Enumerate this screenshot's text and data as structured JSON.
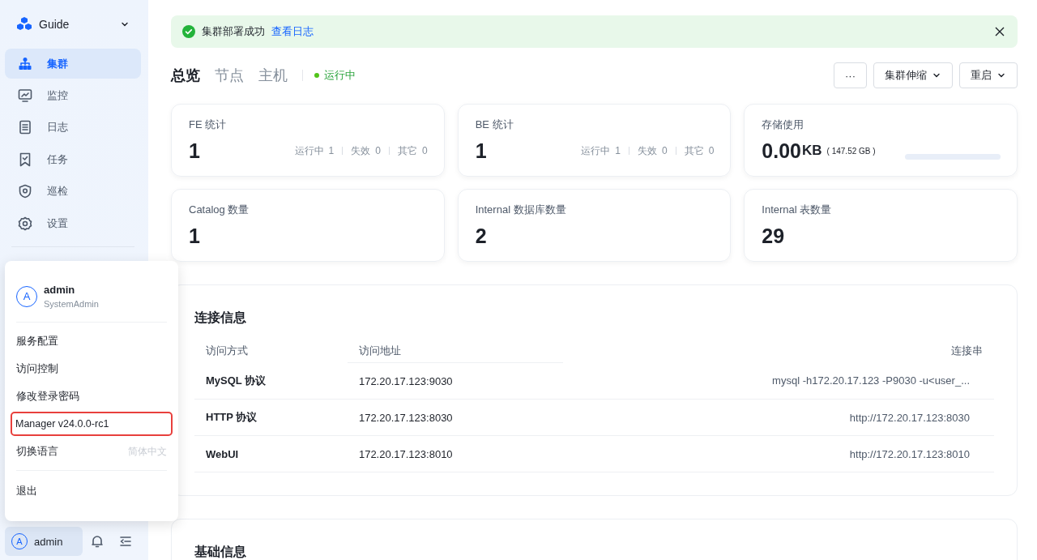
{
  "sidebar": {
    "project": "Guide",
    "nav": [
      {
        "label": "集群",
        "selected": true
      },
      {
        "label": "监控",
        "selected": false
      },
      {
        "label": "日志",
        "selected": false
      },
      {
        "label": "任务",
        "selected": false
      },
      {
        "label": "巡检",
        "selected": false
      },
      {
        "label": "设置",
        "selected": false
      }
    ],
    "user": {
      "avatar": "A",
      "name": "admin"
    }
  },
  "user_menu": {
    "avatar": "A",
    "name": "admin",
    "role": "SystemAdmin",
    "groups": [
      [
        {
          "label": "服务配置",
          "highlighted": false
        },
        {
          "label": "访问控制",
          "highlighted": false
        },
        {
          "label": "修改登录密码",
          "highlighted": false
        },
        {
          "label": "Manager v24.0.0-rc1",
          "highlighted": true
        },
        {
          "label": "切换语言",
          "value": "简体中文",
          "highlighted": false
        }
      ],
      [
        {
          "label": "退出",
          "highlighted": false
        }
      ]
    ]
  },
  "alert": {
    "message": "集群部署成功",
    "link": "查看日志"
  },
  "tabs": [
    {
      "label": "总览",
      "selected": true
    },
    {
      "label": "节点",
      "selected": false
    },
    {
      "label": "主机",
      "selected": false
    }
  ],
  "status": {
    "label": "运行中",
    "color": "#52c41a"
  },
  "actions": [
    {
      "label": "···",
      "dropdown": false
    },
    {
      "label": "集群伸缩",
      "dropdown": true
    },
    {
      "label": "重启",
      "dropdown": true
    }
  ],
  "stats": [
    {
      "kind": "count",
      "title": "FE 统计",
      "value": "1",
      "breakdown": [
        {
          "label": "运行中",
          "value": "1"
        },
        {
          "label": "失效",
          "value": "0"
        },
        {
          "label": "其它",
          "value": "0"
        }
      ]
    },
    {
      "kind": "count",
      "title": "BE 统计",
      "value": "1",
      "breakdown": [
        {
          "label": "运行中",
          "value": "1"
        },
        {
          "label": "失效",
          "value": "0"
        },
        {
          "label": "其它",
          "value": "0"
        }
      ]
    },
    {
      "kind": "storage",
      "title": "存储使用",
      "value": "0.00",
      "unit": "KB",
      "total": "( 147.52 GB )",
      "level": 0
    },
    {
      "kind": "count",
      "title": "Catalog 数量",
      "value": "1"
    },
    {
      "kind": "count",
      "title": "Internal 数据库数量",
      "value": "2"
    },
    {
      "kind": "count",
      "title": "Internal 表数量",
      "value": "29"
    }
  ],
  "connection": {
    "title": "连接信息",
    "columns": [
      "访问方式",
      "访问地址",
      "连接串"
    ],
    "rows": [
      [
        "MySQL 协议",
        "172.20.17.123:9030",
        "mysql -h172.20.17.123 -P9030 -u<user_..."
      ],
      [
        "HTTP 协议",
        "172.20.17.123:8030",
        "http://172.20.17.123:8030"
      ],
      [
        "WebUI",
        "172.20.17.123:8010",
        "http://172.20.17.123:8010"
      ]
    ]
  },
  "basic": {
    "title": "基础信息"
  }
}
